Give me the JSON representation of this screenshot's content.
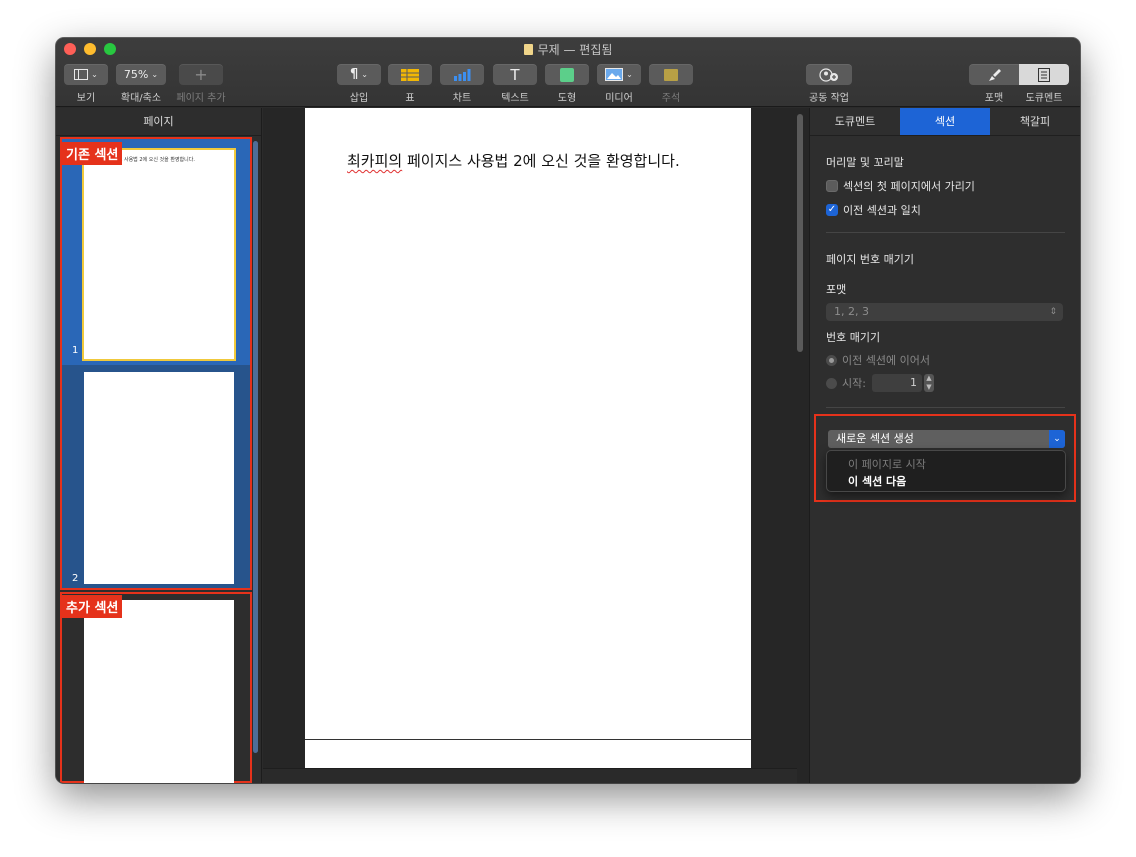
{
  "window": {
    "title": "무제 — 편집됨"
  },
  "toolbar": {
    "view": {
      "label": "보기"
    },
    "zoom": {
      "value": "75%",
      "label": "확대/축소"
    },
    "add_page": {
      "label": "페이지 추가"
    },
    "insert": {
      "label": "삽입"
    },
    "table": {
      "label": "표"
    },
    "chart": {
      "label": "차트"
    },
    "text": {
      "label": "텍스트"
    },
    "shape": {
      "label": "도형"
    },
    "media": {
      "label": "미디어"
    },
    "comment": {
      "label": "주석"
    },
    "collaborate": {
      "label": "공동 작업"
    },
    "format": {
      "label": "포맷"
    },
    "document": {
      "label": "도큐멘트"
    }
  },
  "sidebar": {
    "title": "페이지",
    "existing_section_label": "기존 섹션",
    "added_section_label": "추가 섹션",
    "thumbnail_text": "최카피의 페이지스 사용법 2에 오신 것을 환영합니다.",
    "pages": [
      {
        "number": "1"
      },
      {
        "number": "2"
      }
    ]
  },
  "document": {
    "body_prefix_misspelled": "최카피의",
    "body_rest": " 페이지스 사용법 2에 오신 것을 환영합니다."
  },
  "inspector": {
    "tabs": [
      "도큐멘트",
      "섹션",
      "책갈피"
    ],
    "active_tab": "섹션",
    "header_footer": {
      "title": "머리말 및 꼬리말",
      "hide_on_first_page": {
        "label": "섹션의 첫 페이지에서 가리기",
        "checked": false
      },
      "match_previous": {
        "label": "이전 섹션과 일치",
        "checked": true
      }
    },
    "page_numbering": {
      "title": "페이지 번호 매기기",
      "format_label": "포맷",
      "format_value": "1, 2, 3",
      "numbering_label": "번호 매기기",
      "continue_label": "이전 섹션에 이어서",
      "start_label": "시작:",
      "start_value": "1"
    },
    "new_section": {
      "button_label": "새로운 섹션 생성",
      "options": [
        "이 페이지로 시작",
        "이 섹션 다음"
      ],
      "highlighted_option": "이 섹션 다음"
    }
  },
  "colors": {
    "accent": "#1d64d6",
    "annotation": "#e5321b",
    "selection_border": "#f0c93c"
  }
}
